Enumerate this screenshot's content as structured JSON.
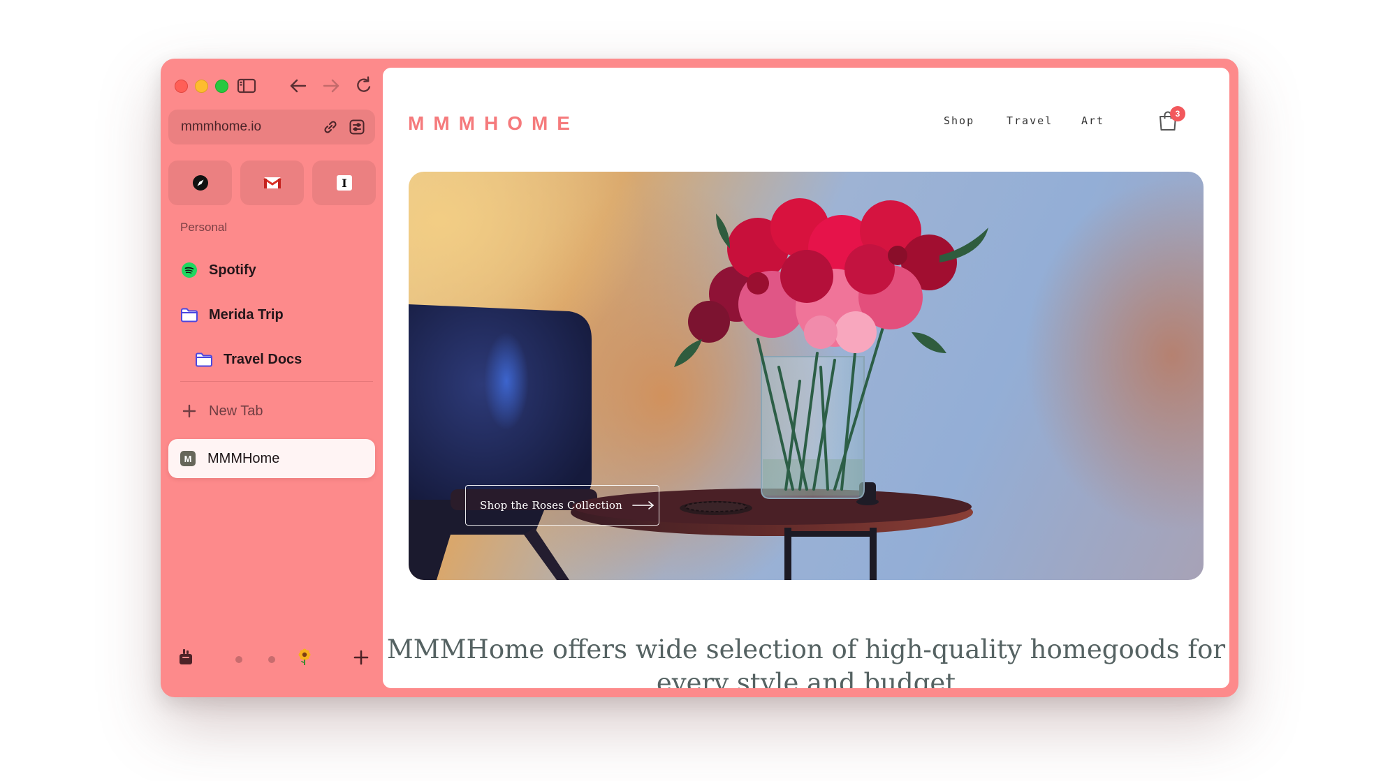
{
  "browser": {
    "url": "mmmhome.io",
    "pinned": [
      {
        "name": "compass-icon"
      },
      {
        "name": "gmail-icon"
      },
      {
        "name": "instapaper-icon"
      }
    ],
    "section_label": "Personal",
    "tabs": [
      {
        "label": "Spotify",
        "icon": "spotify-icon",
        "indent": 0
      },
      {
        "label": "Merida Trip",
        "icon": "folder-icon",
        "indent": 0
      },
      {
        "label": "Travel Docs",
        "icon": "folder-icon",
        "indent": 1
      }
    ],
    "new_tab_label": "New Tab",
    "active_tab": {
      "label": "MMMHome",
      "favicon_letter": "M"
    },
    "accent_color": "#fd8a8b"
  },
  "site": {
    "logo": "MMMHOME",
    "nav": [
      "Shop",
      "Travel",
      "Art"
    ],
    "cart_count": "3",
    "hero": {
      "cta_label": "Shop the Roses Collection"
    },
    "tagline": "MMMHome offers wide selection of high-quality homegoods for every style and budget"
  }
}
